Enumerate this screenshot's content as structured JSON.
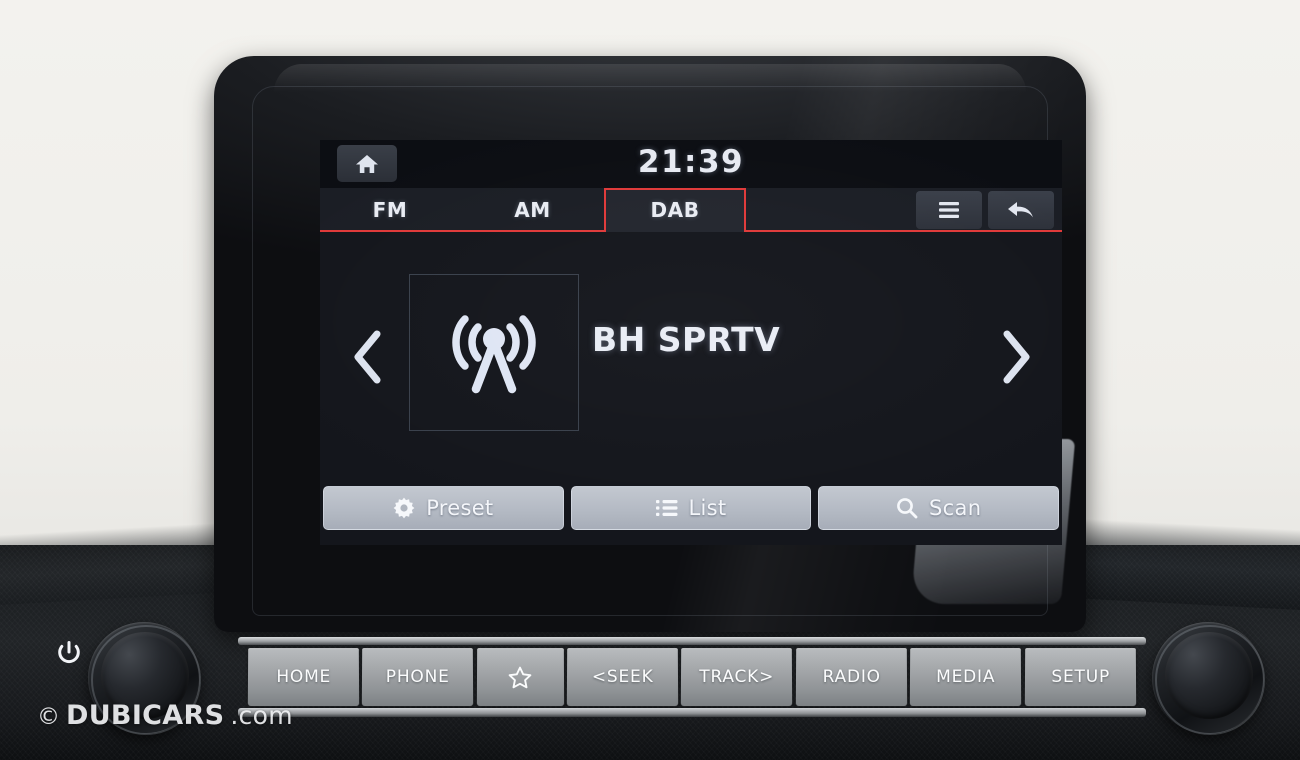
{
  "status_bar": {
    "home_icon": "home-icon",
    "clock": "21:39"
  },
  "tabs": [
    {
      "label": "FM",
      "active": false
    },
    {
      "label": "AM",
      "active": false
    },
    {
      "label": "DAB",
      "active": true
    }
  ],
  "tab_actions": [
    {
      "icon": "hamburger-menu-icon",
      "name": "menu-button"
    },
    {
      "icon": "back-arrow-icon",
      "name": "back-button"
    }
  ],
  "now_playing": {
    "station": "BH SPRTV",
    "artwork_icon": "broadcast-antenna-icon",
    "prev_icon": "chevron-left-icon",
    "next_icon": "chevron-right-icon"
  },
  "soft_buttons": [
    {
      "label": "Preset",
      "icon": "gear-icon"
    },
    {
      "label": "List",
      "icon": "list-icon"
    },
    {
      "label": "Scan",
      "icon": "search-icon"
    }
  ],
  "hardware_buttons": [
    {
      "label": "HOME",
      "icon": ""
    },
    {
      "label": "PHONE",
      "icon": ""
    },
    {
      "label": "",
      "icon": "star-icon"
    },
    {
      "label": "<SEEK",
      "icon": ""
    },
    {
      "label": "TRACK>",
      "icon": ""
    },
    {
      "label": "RADIO",
      "icon": ""
    },
    {
      "label": "MEDIA",
      "icon": ""
    },
    {
      "label": "SETUP",
      "icon": ""
    }
  ],
  "knobs": {
    "left": {
      "name": "power-volume-knob",
      "icon": "power-icon"
    },
    "right": {
      "name": "tune-knob"
    }
  },
  "watermark": {
    "copyright": "©",
    "brand": "DUBICARS",
    "tld": ".com"
  },
  "colors": {
    "accent_red": "#e03a3a",
    "screen_bg": "#14161c",
    "text_light": "#e9edf5"
  }
}
